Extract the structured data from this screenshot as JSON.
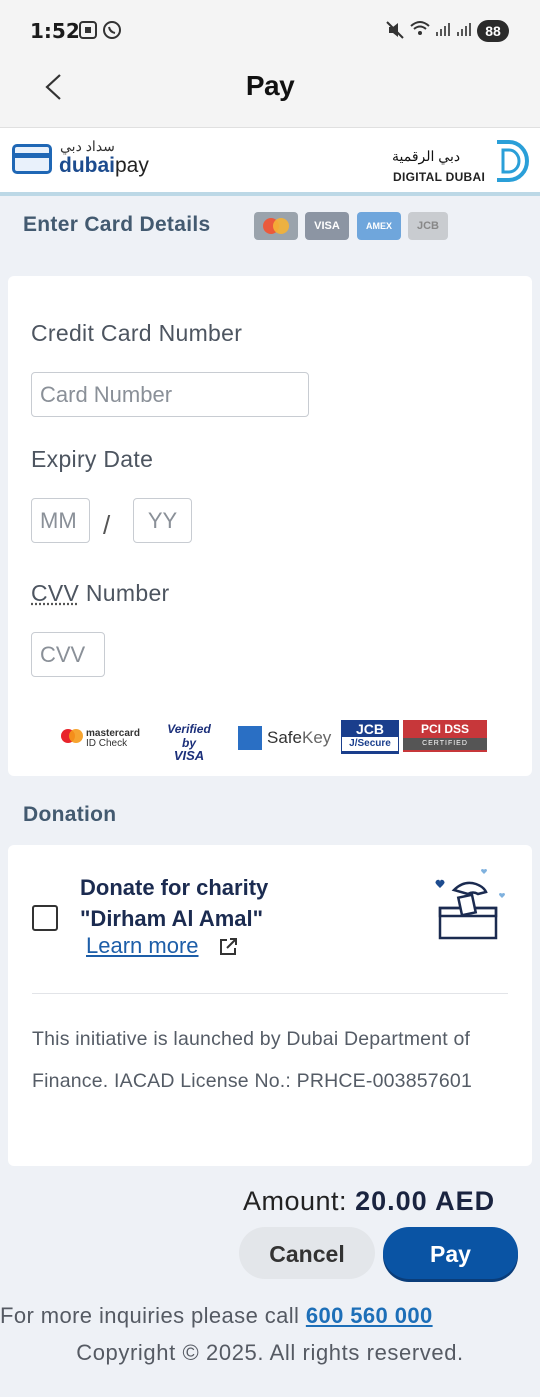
{
  "status_bar": {
    "time": "1:52",
    "battery": "88"
  },
  "app_bar": {
    "title": "Pay"
  },
  "brand": {
    "dubaipay_arabic": "سداد دبي",
    "dubaipay_name_bold": "dubai",
    "dubaipay_name_rest": "pay",
    "digital_dubai_arabic": "دبي الرقمية",
    "digital_dubai_name": "DIGITAL DUBAI"
  },
  "card_section": {
    "title": "Enter Card Details",
    "accepted_cards": [
      "mastercard",
      "VISA",
      "AMEX",
      "JCB"
    ],
    "card_number_label": "Credit Card Number",
    "card_number_placeholder": "Card Number",
    "expiry_label": "Expiry Date",
    "month_placeholder": "MM",
    "separator": "/",
    "year_placeholder": "YY",
    "cvv_label_abbr": "CVV",
    "cvv_label_rest": " Number",
    "cvv_placeholder": "CVV",
    "security_logos": {
      "mastercard_l1": "mastercard",
      "mastercard_l2": "ID Check",
      "verified_l1": "Verified by",
      "verified_l2": "VISA",
      "safekey_safe": "Safe",
      "safekey_key": "Key",
      "jcb_l1": "JCB",
      "jcb_l2": "J/Secure",
      "pci_l1": "PCI DSS",
      "pci_l2": "CERTIFIED"
    }
  },
  "donation": {
    "section_title": "Donation",
    "title_line1": "Donate for charity",
    "title_line2": "\"Dirham Al Amal\"",
    "learn_more": "Learn more",
    "checked": false,
    "info_text": "This initiative is launched by Dubai Department of Finance. IACAD License No.: PRHCE-003857601"
  },
  "footer": {
    "amount_label": "Amount:",
    "amount_value": "20.00 AED",
    "cancel_label": "Cancel",
    "pay_label": "Pay",
    "inquiry_text": "For more inquiries please call ",
    "inquiry_phone": "600 560 000",
    "copyright": "Copyright © 2025. All rights reserved."
  },
  "colors": {
    "primary": "#0a54a4",
    "background": "#eef1f6",
    "section_title": "#435a70",
    "link": "#1d6fb8"
  }
}
